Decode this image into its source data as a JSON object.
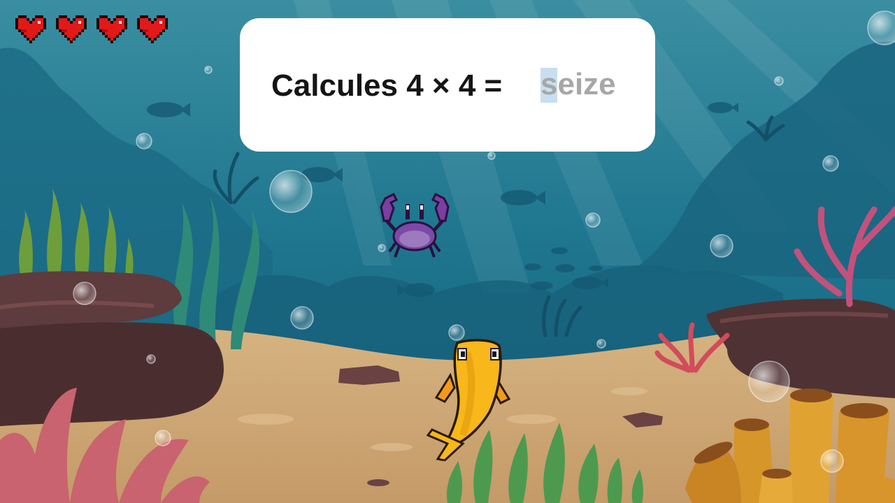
{
  "game": {
    "lives": 4,
    "heart_icon": "heart-icon"
  },
  "question": {
    "prompt": "Calcules 4 × 4 =",
    "answer_value": "seize"
  },
  "characters": {
    "enemy": "crab-icon",
    "player": "fish-icon"
  },
  "colors": {
    "water_top": "#2a7f96",
    "water_mid": "#1a6f86",
    "sand": "#d1ad7c",
    "rock": "#5a3a3b",
    "heart": "#e21919",
    "card": "#ffffff"
  }
}
